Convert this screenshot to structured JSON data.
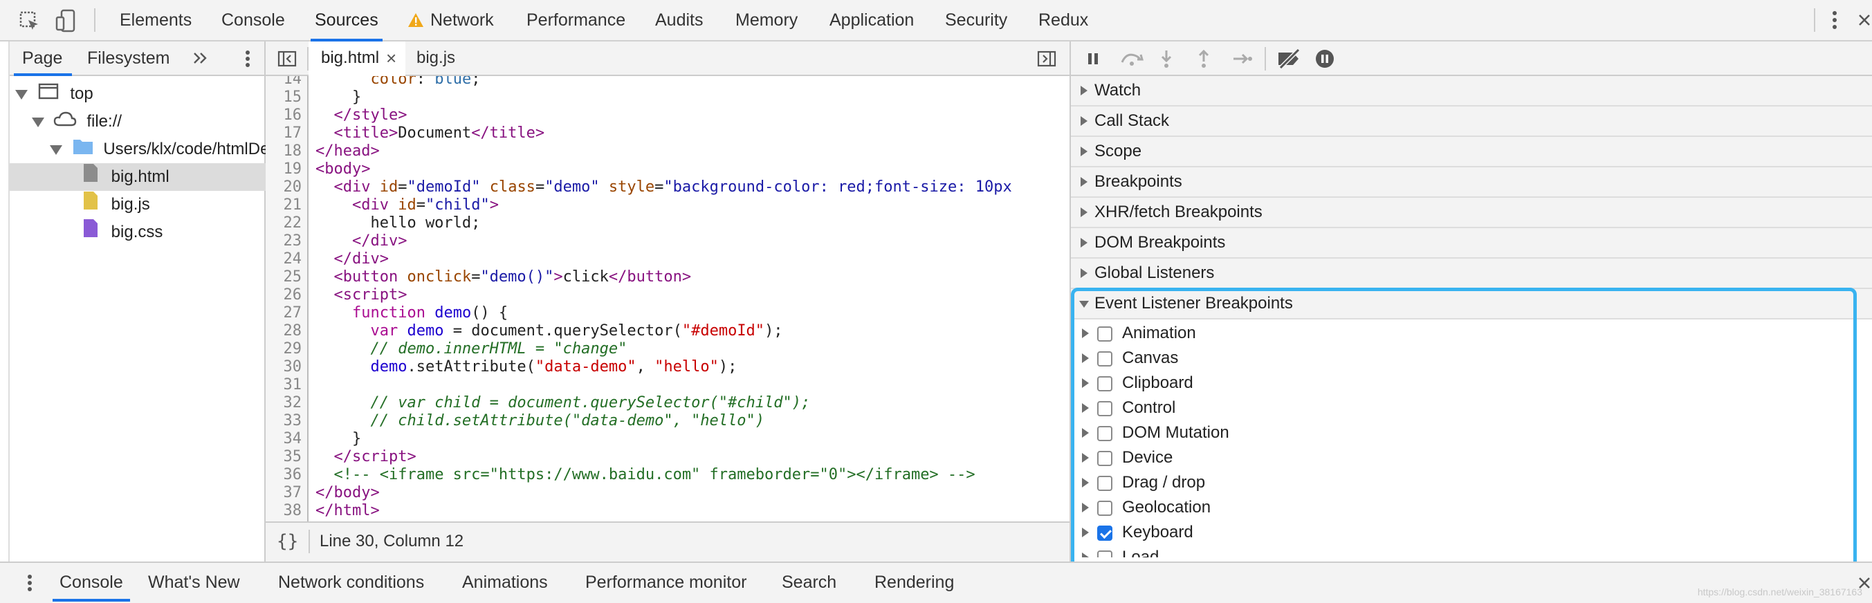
{
  "toolbar": {
    "tabs": [
      "Elements",
      "Console",
      "Sources",
      "Network",
      "Performance",
      "Audits",
      "Memory",
      "Application",
      "Security",
      "Redux"
    ],
    "active_tab": "Sources",
    "network_warning_icon": "warning-icon"
  },
  "navigator": {
    "tabs": [
      "Page",
      "Filesystem"
    ],
    "tree": {
      "top": "top",
      "origin": "file://",
      "folder": "Users/klx/code/htmlDe",
      "files": [
        "big.html",
        "big.js",
        "big.css"
      ]
    }
  },
  "editor": {
    "tabs": [
      "big.html",
      "big.js"
    ],
    "close_glyph": "×",
    "line_numbers": [
      "14",
      "15",
      "16",
      "17",
      "18",
      "19",
      "20",
      "21",
      "22",
      "23",
      "24",
      "25",
      "26",
      "27",
      "28",
      "29",
      "30",
      "31",
      "32",
      "33",
      "34",
      "35",
      "36",
      "37",
      "38"
    ],
    "status": "Line 30, Column 12",
    "pretty_print": "{}"
  },
  "debugger": {
    "panes": [
      "Watch",
      "Call Stack",
      "Scope",
      "Breakpoints",
      "XHR/fetch Breakpoints",
      "DOM Breakpoints",
      "Global Listeners",
      "Event Listener Breakpoints"
    ],
    "event_categories": [
      {
        "label": "Animation",
        "checked": false
      },
      {
        "label": "Canvas",
        "checked": false
      },
      {
        "label": "Clipboard",
        "checked": false
      },
      {
        "label": "Control",
        "checked": false
      },
      {
        "label": "DOM Mutation",
        "checked": false
      },
      {
        "label": "Device",
        "checked": false
      },
      {
        "label": "Drag / drop",
        "checked": false
      },
      {
        "label": "Geolocation",
        "checked": false
      },
      {
        "label": "Keyboard",
        "checked": true
      },
      {
        "label": "Load",
        "checked": false
      }
    ]
  },
  "drawer": {
    "tabs": [
      "Console",
      "What's New",
      "Network conditions",
      "Animations",
      "Performance monitor",
      "Search",
      "Rendering"
    ],
    "watermark": "https://blog.csdn.net/weixin_38167163"
  },
  "colors": {
    "accent": "#1a73e8",
    "highlight": "#39b3f0",
    "warning": "#f0a81a"
  }
}
